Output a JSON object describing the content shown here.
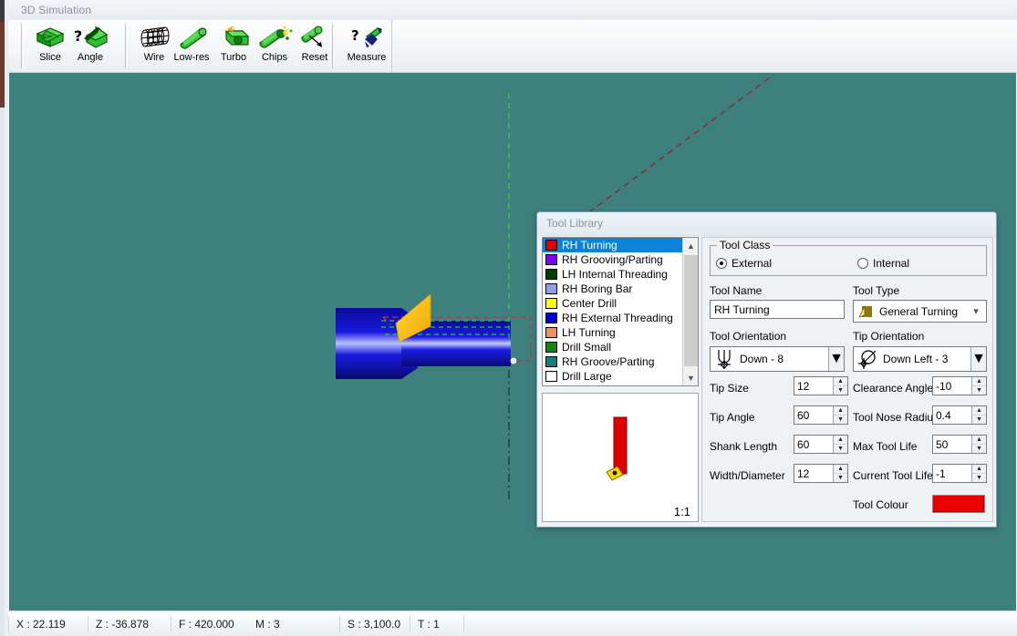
{
  "window": {
    "title": "3D Simulation"
  },
  "toolbar": {
    "groups": [
      {
        "buttons": [
          {
            "label": "Slice",
            "icon": "slice-icon"
          },
          {
            "label": "Angle",
            "icon": "angle-icon"
          }
        ]
      },
      {
        "buttons": [
          {
            "label": "Wire",
            "icon": "wireframe-icon"
          },
          {
            "label": "Low-res",
            "icon": "lowres-icon"
          },
          {
            "label": "Turbo",
            "icon": "turbo-icon"
          },
          {
            "label": "Chips",
            "icon": "chips-icon"
          },
          {
            "label": "Reset",
            "icon": "reset-icon"
          }
        ]
      },
      {
        "buttons": [
          {
            "label": "Measure",
            "icon": "measure-icon"
          }
        ]
      }
    ]
  },
  "dialog": {
    "title": "Tool Library",
    "tool_list": [
      {
        "name": "RH Turning",
        "colour": "#e00000",
        "selected": true
      },
      {
        "name": "RH Grooving/Parting",
        "colour": "#7f00ff",
        "selected": false
      },
      {
        "name": "LH Internal Threading",
        "colour": "#004000",
        "selected": false
      },
      {
        "name": "RH Boring Bar",
        "colour": "#8f9fe8",
        "selected": false
      },
      {
        "name": "Center Drill",
        "colour": "#ffff00",
        "selected": false
      },
      {
        "name": "RH External Threading",
        "colour": "#0000d8",
        "selected": false
      },
      {
        "name": "LH Turning",
        "colour": "#f29060",
        "selected": false
      },
      {
        "name": "Drill Small",
        "colour": "#108810",
        "selected": false
      },
      {
        "name": "RH Groove/Parting",
        "colour": "#10807f",
        "selected": false
      },
      {
        "name": "Drill Large",
        "colour": "#ffffff",
        "selected": false
      }
    ],
    "preview": {
      "scale": "1:1",
      "shank_colour": "#e00000",
      "tip_colour": "#ffd700"
    },
    "tool_class": {
      "legend": "Tool Class",
      "options": [
        {
          "label": "External",
          "selected": true
        },
        {
          "label": "Internal",
          "selected": false
        }
      ]
    },
    "fields": {
      "tool_name": {
        "label": "Tool Name",
        "value": "RH Turning"
      },
      "tool_type": {
        "label": "Tool Type",
        "value": "General Turning",
        "icon": "turning-insert-icon"
      },
      "tool_orientation": {
        "label": "Tool Orientation",
        "value": "Down - 8",
        "icon": "orientation-down-icon"
      },
      "tip_orientation": {
        "label": "Tip Orientation",
        "value": "Down Left - 3",
        "icon": "tip-down-left-icon"
      },
      "tip_size": {
        "label": "Tip Size",
        "value": "12"
      },
      "clearance_angle": {
        "label": "Clearance Angle",
        "value": "-10"
      },
      "tip_angle": {
        "label": "Tip Angle",
        "value": "60"
      },
      "tool_nose_radius": {
        "label": "Tool Nose Radius",
        "value": "0.4"
      },
      "shank_length": {
        "label": "Shank Length",
        "value": "60"
      },
      "max_tool_life": {
        "label": "Max Tool Life",
        "value": "50"
      },
      "width_diameter": {
        "label": "Width/Diameter",
        "value": "12"
      },
      "current_tool_life": {
        "label": "Current Tool Life",
        "value": "-1"
      },
      "tool_colour": {
        "label": "Tool Colour",
        "value": "#ee0000"
      }
    }
  },
  "statusbar": {
    "cells": [
      {
        "text": "X : 22.119"
      },
      {
        "text": "Z : -36.878"
      },
      {
        "text": "F : 420.000"
      },
      {
        "text": "M : 3"
      },
      {
        "text": "S : 3,100.0"
      },
      {
        "text": "T : 1"
      }
    ]
  },
  "viewport": {
    "background": "#3d807e",
    "workpiece_colour": "#1414dc",
    "tool_colour": "#f5c518",
    "toolpath_colour": "#c03030",
    "stock_outline_colour": "#22d022"
  }
}
